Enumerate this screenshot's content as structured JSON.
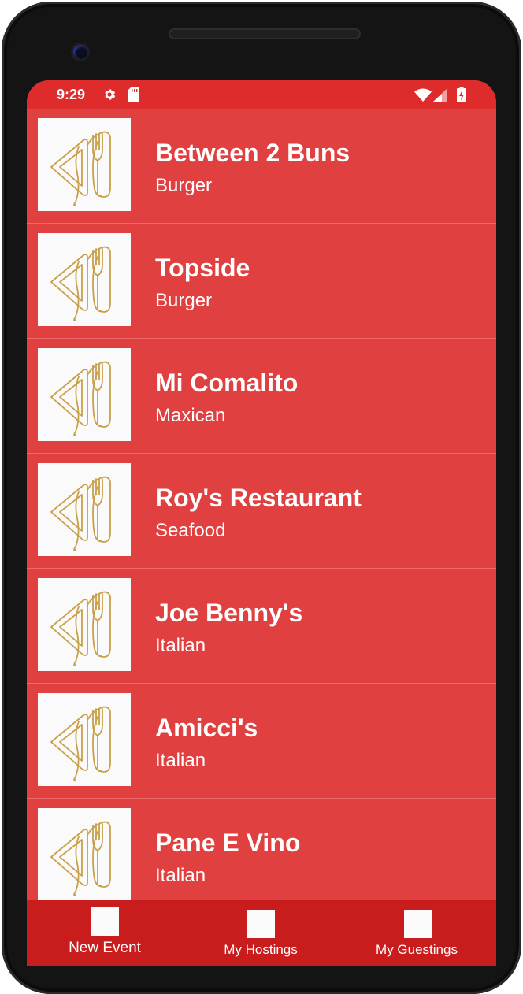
{
  "status_bar": {
    "time": "9:29",
    "icons": [
      "gear-icon",
      "sd-card-icon",
      "wifi-icon",
      "cell-signal-icon",
      "battery-charging-icon"
    ]
  },
  "restaurants": [
    {
      "name": "Between 2 Buns",
      "category": "Burger"
    },
    {
      "name": "Topside",
      "category": "Burger"
    },
    {
      "name": "Mi Comalito",
      "category": "Maxican"
    },
    {
      "name": "Roy's Restaurant",
      "category": "Seafood"
    },
    {
      "name": "Joe Benny's",
      "category": "Italian"
    },
    {
      "name": "Amicci's",
      "category": "Italian"
    },
    {
      "name": "Pane E Vino",
      "category": "Italian"
    }
  ],
  "bottom_nav": [
    {
      "label": "New Event",
      "icon": "new-event-icon"
    },
    {
      "label": "My Hostings",
      "icon": "my-hostings-icon"
    },
    {
      "label": "My Guestings",
      "icon": "my-guestings-icon"
    }
  ],
  "colors": {
    "status_bar": "#de2c2c",
    "list_background": "#e04040",
    "bottom_nav": "#c91d1d",
    "logo_line": "#c8a04a"
  }
}
